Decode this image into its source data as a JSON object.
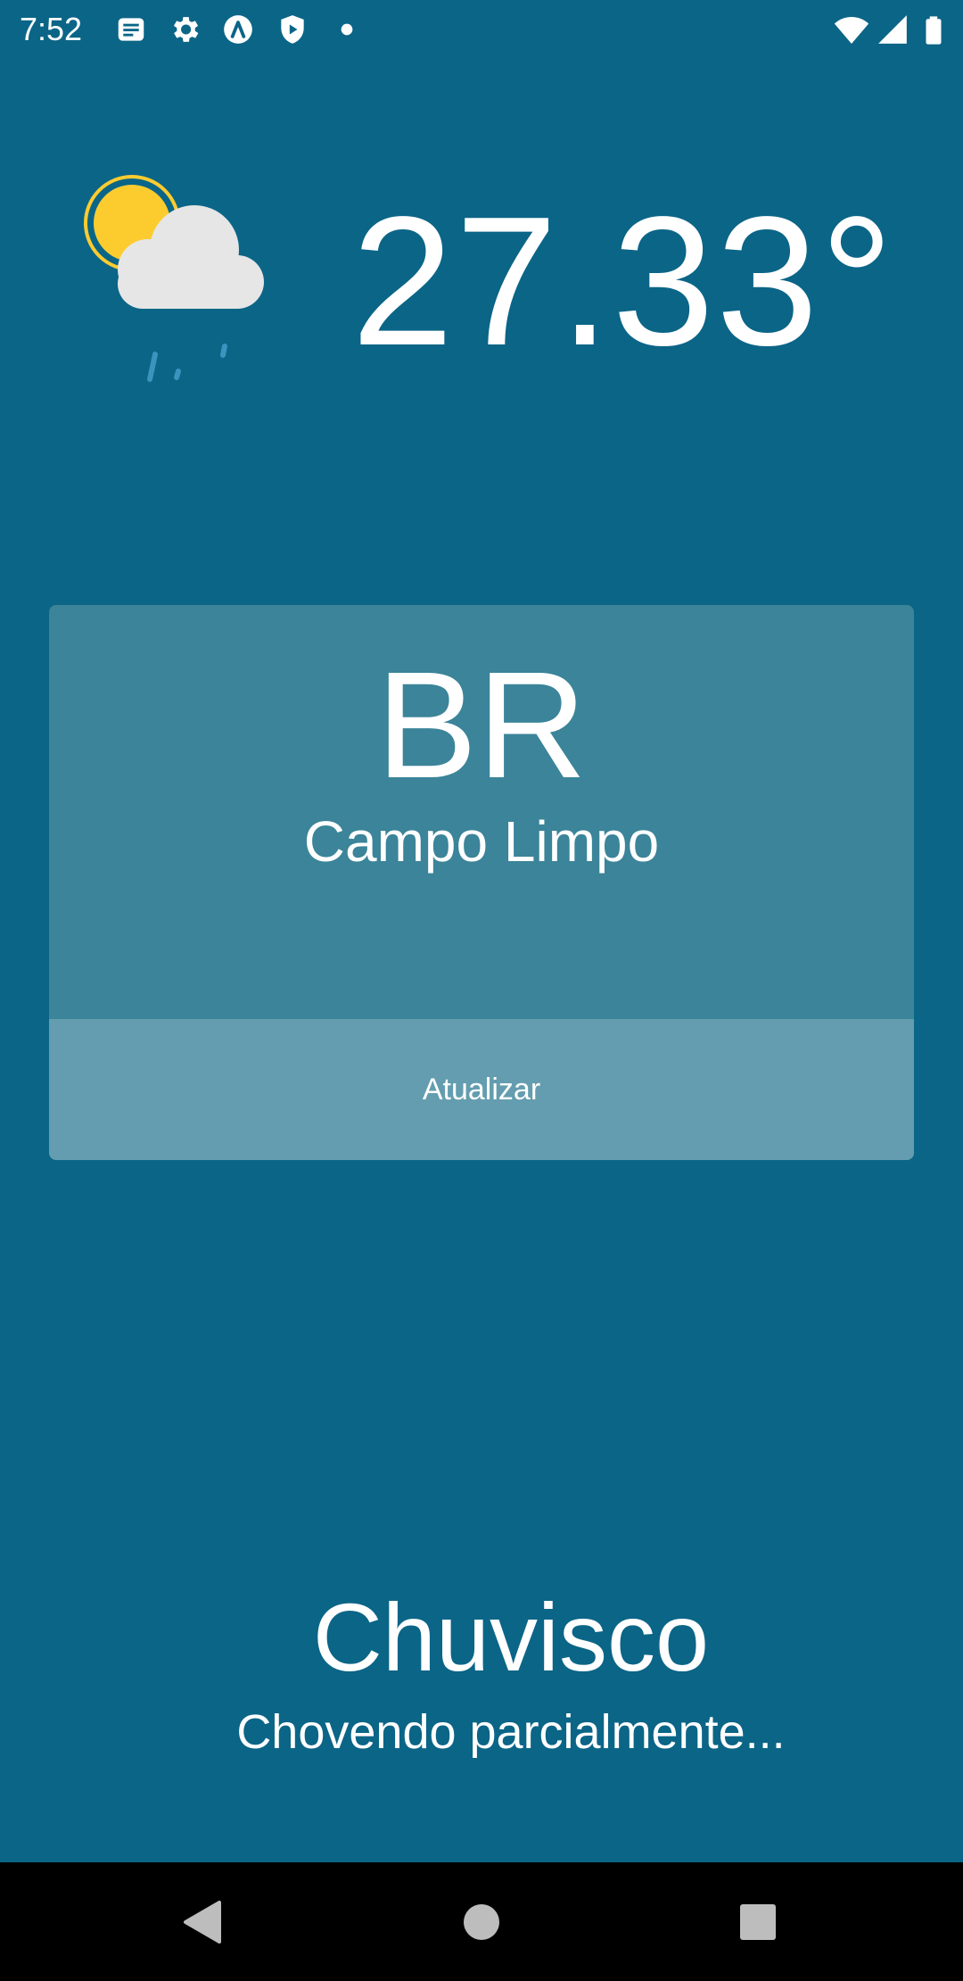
{
  "status_bar": {
    "time": "7:52",
    "icons": [
      "notes-icon",
      "settings-gear-icon",
      "accessibility-icon",
      "shield-play-icon",
      "dot-icon",
      "wifi-icon",
      "signal-icon",
      "battery-icon"
    ]
  },
  "weather": {
    "icon": "partly-cloudy-rain-icon",
    "temperature": "27.33°"
  },
  "location": {
    "country_code": "BR",
    "city": "Campo Limpo",
    "refresh_label": "Atualizar"
  },
  "condition": {
    "title": "Chuvisco",
    "description": "Chovendo parcialmente..."
  },
  "colors": {
    "background": "#0b6587",
    "card": "#3b8499",
    "button": "#639daf",
    "sun": "#fccc2f",
    "cloud": "#e6e6e6",
    "rain": "#3b93be",
    "nav_bar": "#000000",
    "nav_icons": "#bdbdbd"
  },
  "nav_bar": {
    "icons": [
      "back-icon",
      "home-icon",
      "recents-icon"
    ]
  }
}
